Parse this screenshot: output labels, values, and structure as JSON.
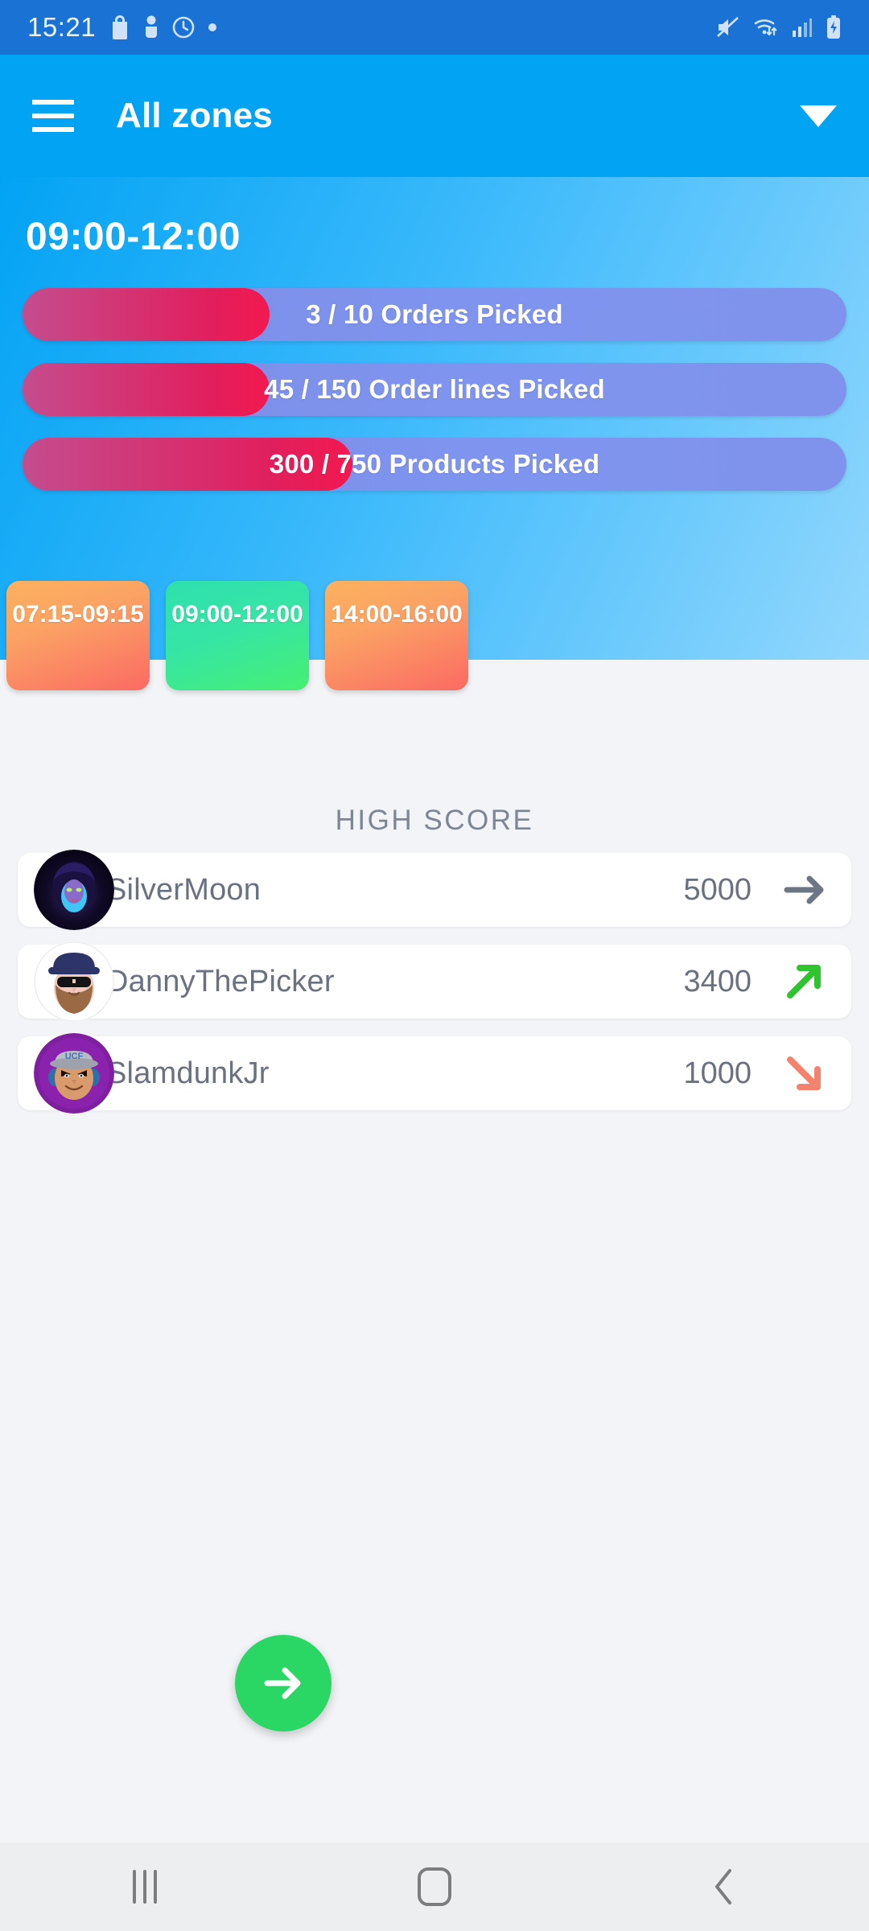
{
  "status_bar": {
    "clock": "15:21",
    "left_icons": [
      "bag-icon",
      "person-icon",
      "alarm-icon",
      "dot-icon"
    ],
    "right_icons": [
      "mute-icon",
      "wifi-icon",
      "signal-icon",
      "battery-charging-icon"
    ],
    "background": "#1a73d4"
  },
  "app_bar": {
    "menu_icon": "hamburger-icon",
    "title": "All zones",
    "dropdown_icon": "caret-down-icon",
    "background": "#03a3f4"
  },
  "hero": {
    "time_range": "09:00-12:00",
    "progress": [
      {
        "current": "3",
        "total": "10",
        "unit": "Orders Picked",
        "label": "3 / 10 Orders Picked",
        "percent": 30
      },
      {
        "current": "45",
        "total": "150",
        "unit": "Order lines Picked",
        "label": "45 / 150 Order lines Picked",
        "percent": 30
      },
      {
        "current": "300",
        "total": "750",
        "unit": "Products Picked",
        "label": "300 / 750 Products Picked",
        "percent": 40
      }
    ],
    "fill_color": "#e8215a",
    "track_color": "#7f93ec"
  },
  "slots": [
    {
      "label": "07:15-09:15",
      "state": "inactive",
      "color": "#fb8a61"
    },
    {
      "label": "09:00-12:00",
      "state": "active",
      "color": "#35e69d"
    },
    {
      "label": "14:00-16:00",
      "state": "inactive",
      "color": "#fb8a61"
    }
  ],
  "high_score": {
    "heading": "HIGH SCORE",
    "rows": [
      {
        "avatar": "avatar-silvermoon",
        "name": "SilverMoon",
        "score": "5000",
        "trend": "arrow-right-icon",
        "trend_color": "#6c7684"
      },
      {
        "avatar": "avatar-dannythepicker",
        "name": "DannyThePicker",
        "score": "3400",
        "trend": "arrow-up-right-icon",
        "trend_color": "#2ec42e"
      },
      {
        "avatar": "avatar-slamdunkjr",
        "name": "SlamdunkJr",
        "score": "1000",
        "trend": "arrow-down-right-icon",
        "trend_color": "#f4836e"
      }
    ]
  },
  "fab": {
    "icon": "arrow-right-icon",
    "color": "#2ad765"
  },
  "nav_bar": {
    "recents_label": "recents-icon",
    "home_label": "home-icon",
    "back_label": "back-icon"
  }
}
